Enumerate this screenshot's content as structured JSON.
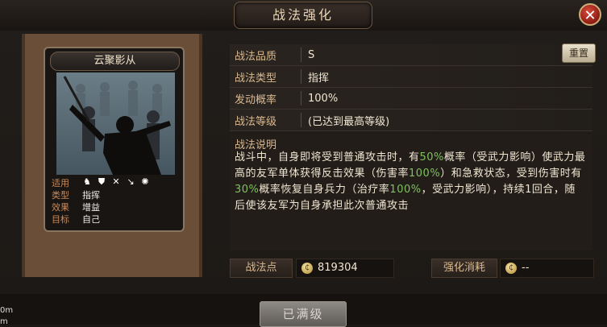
{
  "window": {
    "title": "战法强化",
    "close_icon": "close-icon"
  },
  "card": {
    "name": "云聚影从",
    "suitable_label": "适用",
    "suitable_units": [
      "cavalry-icon",
      "shield-icon",
      "bow-icon",
      "spear-icon",
      "chariot-icon"
    ],
    "type_label": "类型",
    "type_value": "指挥",
    "effect_label": "效果",
    "effect_value": "增益",
    "target_label": "目标",
    "target_value": "自己"
  },
  "attributes": [
    {
      "label": "战法品质",
      "value": "S"
    },
    {
      "label": "战法类型",
      "value": "指挥"
    },
    {
      "label": "发动概率",
      "value": "100%"
    },
    {
      "label": "战法等级",
      "value": "(已达到最高等级)"
    }
  ],
  "reset_button": "重置",
  "description": {
    "title": "战法说明",
    "parts": [
      {
        "text": "战斗中，自身即将受到普通攻击时，有",
        "hl": false
      },
      {
        "text": "50%",
        "hl": true
      },
      {
        "text": "概率（受武力影响）使武力最高的友军单体获得反击效果（伤害率",
        "hl": false
      },
      {
        "text": "100%",
        "hl": true
      },
      {
        "text": "）和急救状态，受到伤害时有",
        "hl": false
      },
      {
        "text": "30%",
        "hl": true
      },
      {
        "text": "概率恢复自身兵力（治疗率",
        "hl": false
      },
      {
        "text": "100%",
        "hl": true
      },
      {
        "text": "，受武力影响），持续1回合，随后使该友军为自身承担此次普通攻击",
        "hl": false
      }
    ]
  },
  "points": {
    "label": "战法点",
    "value": "819304"
  },
  "cost": {
    "label": "强化消耗",
    "value": "--"
  },
  "maxed_button": "已满级",
  "side_labels": [
    "0m",
    "m"
  ],
  "colors": {
    "highlight": "#7fc25e",
    "accent": "#d9b98f"
  }
}
